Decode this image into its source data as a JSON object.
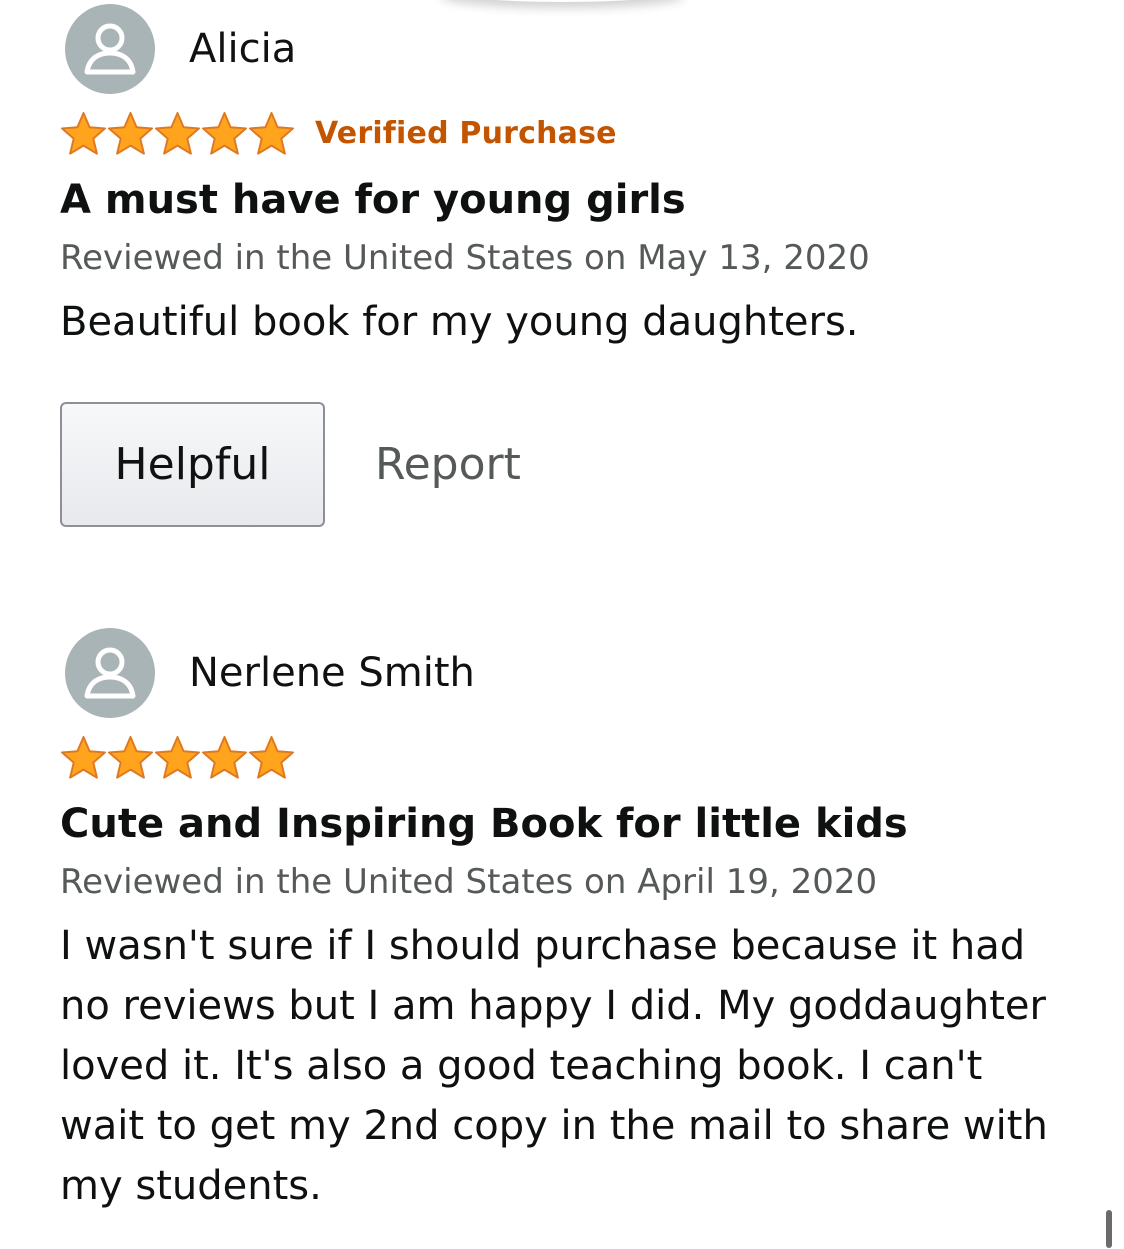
{
  "colors": {
    "star": "#ffa41c",
    "star_outline": "#de7921",
    "verified": "#c45500",
    "avatar": "#a9b4b7",
    "date_text": "#565959"
  },
  "reviews": [
    {
      "reviewer": "Alicia",
      "avatar_icon": "person-icon",
      "rating": 5,
      "rating_max": 5,
      "verified_label": "Verified Purchase",
      "title": "A must have for young girls",
      "date": "Reviewed in the United States on May 13, 2020",
      "body": "Beautiful book for my young daughters.",
      "helpful_label": "Helpful",
      "report_label": "Report"
    },
    {
      "reviewer": "Nerlene Smith",
      "avatar_icon": "person-icon",
      "rating": 5,
      "rating_max": 5,
      "title": "Cute and Inspiring Book for little kids",
      "date": "Reviewed in the United States on April 19, 2020",
      "body": "I wasn't sure if I should purchase because it had no reviews but I am happy I did. My goddaughter loved it. It's also a good teaching book. I can't wait to get my 2nd copy in the mail to share with my students."
    }
  ]
}
